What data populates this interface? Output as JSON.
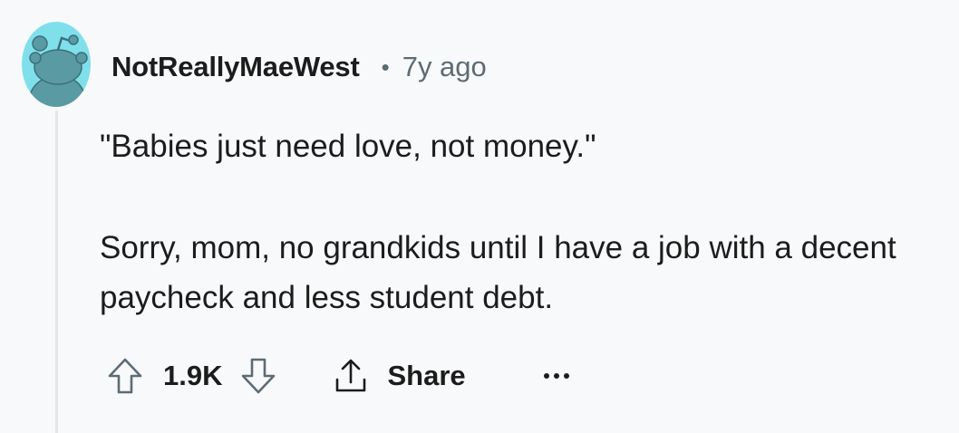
{
  "comment": {
    "author": "NotReallyMaeWest",
    "separator": "•",
    "age": "7y ago",
    "body": [
      "\"Babies just need love, not money.\"",
      "Sorry, mom, no grandkids until I have a job with a decent paycheck and less student debt."
    ],
    "score": "1.9K"
  },
  "actions": {
    "upvote_icon": "arrow-up-icon",
    "downvote_icon": "arrow-down-icon",
    "share_icon": "share-icon",
    "share_label": "Share",
    "more_icon": "ellipsis-icon"
  },
  "colors": {
    "background": "#f8f9fb",
    "avatar_bg": "#7fe0ec",
    "avatar_figure": "#5a9aa3",
    "text": "#1c1c1c",
    "meta": "#5c6c74",
    "thread_line": "#e4e6ea"
  }
}
